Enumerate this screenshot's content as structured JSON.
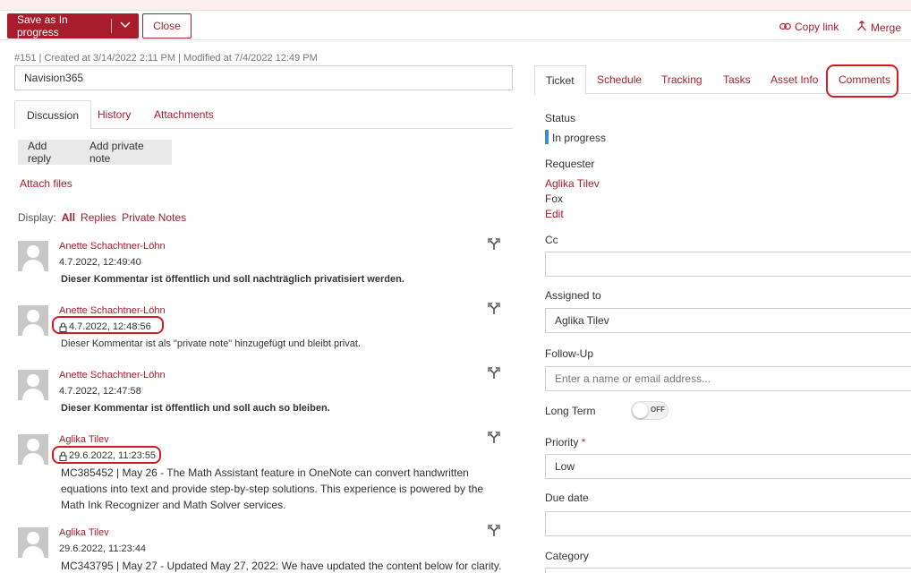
{
  "toolbar": {
    "save_label": "Save as In progress",
    "close_label": "Close",
    "copy_link_label": "Copy link",
    "merge_label": "Merge"
  },
  "ticket": {
    "meta": "#151 | Created at 3/14/2022 2:11 PM | Modified at 7/4/2022 12:49 PM",
    "title": "Navision365"
  },
  "left_tabs": [
    "Discussion",
    "History",
    "Attachments"
  ],
  "actions": {
    "add_reply": "Add reply",
    "add_private_note": "Add private note",
    "attach_files": "Attach files"
  },
  "display_filter": {
    "label": "Display:",
    "options": [
      "All",
      "Replies",
      "Private Notes"
    ],
    "selected": "All"
  },
  "comments": [
    {
      "author": "Anette Schachtner-Löhn",
      "date": "4.7.2022, 12:49:40",
      "private": false,
      "bold": true,
      "text": "Dieser Kommentar ist öffentlich und soll nachträglich privatisiert werden."
    },
    {
      "author": "Anette Schachtner-Löhn",
      "date": "4.7.2022, 12:48:56",
      "private": true,
      "bold": false,
      "text": "Dieser Kommentar ist als \"private note\" hinzugefügt und bleibt privat."
    },
    {
      "author": "Anette Schachtner-Löhn",
      "date": "4.7.2022, 12:47:58",
      "private": false,
      "bold": true,
      "text": "Dieser Kommentar ist öffentlich und soll auch so bleiben."
    },
    {
      "author": "Aglika Tilev",
      "date": "29.6.2022, 11:23:55",
      "private": true,
      "bold": false,
      "text": "MC385452 | May 26 - The Math Assistant feature in OneNote can convert handwritten equations into text and provide step-by-step solutions. This experience is powered by the Math Ink Recognizer and Math Solver services."
    },
    {
      "author": "Aglika Tilev",
      "date": "29.6.2022, 11:23:44",
      "private": false,
      "bold": false,
      "text": "MC343795 | May 27 - Updated May 27, 2022: We have updated the content below for clarity."
    }
  ],
  "right_tabs": [
    "Ticket",
    "Schedule",
    "Tracking",
    "Tasks",
    "Asset Info",
    "Comments"
  ],
  "fields": {
    "status_label": "Status",
    "status_value": "In progress",
    "status_color": "#3d8ad6",
    "requester_label": "Requester",
    "requester_name": "Aglika Tilev",
    "requester_company": "Fox",
    "requester_edit": "Edit",
    "cc_label": "Cc",
    "cc_value": "",
    "assigned_label": "Assigned to",
    "assigned_value": "Aglika Tilev",
    "followup_label": "Follow-Up",
    "followup_placeholder": "Enter a name or email address...",
    "longterm_label": "Long Term",
    "longterm_state": "OFF",
    "priority_label": "Priority",
    "priority_required": "*",
    "priority_value": "Low",
    "duedate_label": "Due date",
    "duedate_value": "",
    "category_label": "Category"
  },
  "colors": {
    "accent": "#a81c2b",
    "highlight": "#d41b22"
  },
  "icons": [
    "chevron-down-icon",
    "link-icon",
    "merge-icon",
    "reply-icon",
    "lock-icon",
    "avatar"
  ]
}
